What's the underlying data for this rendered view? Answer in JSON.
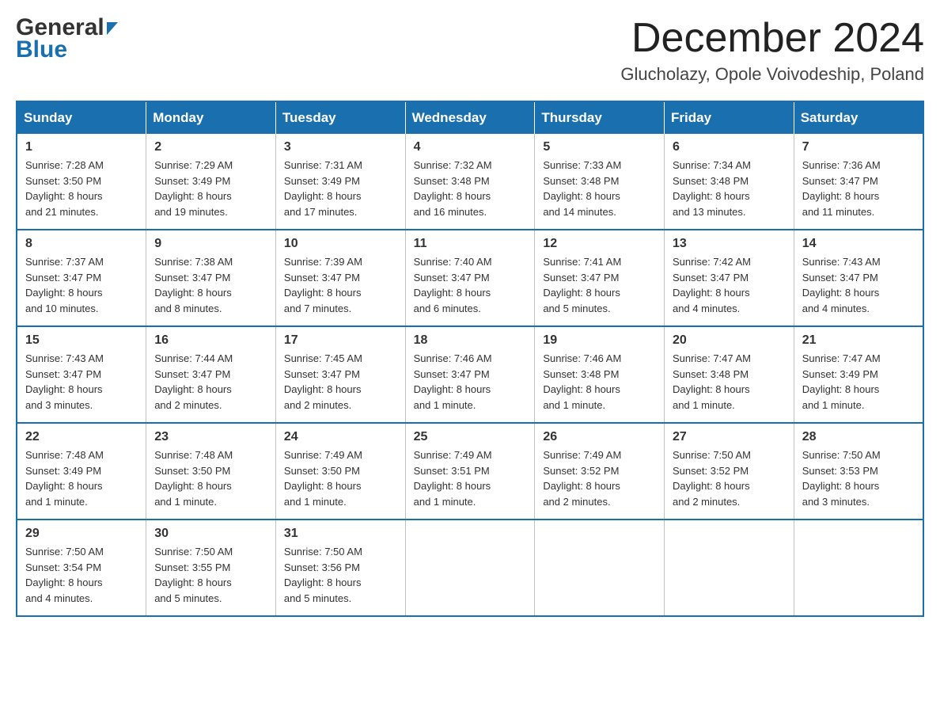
{
  "header": {
    "logo_line1": "General",
    "logo_line2": "Blue",
    "month_title": "December 2024",
    "subtitle": "Glucholazy, Opole Voivodeship, Poland"
  },
  "weekdays": [
    "Sunday",
    "Monday",
    "Tuesday",
    "Wednesday",
    "Thursday",
    "Friday",
    "Saturday"
  ],
  "weeks": [
    [
      {
        "day": "1",
        "sunrise": "7:28 AM",
        "sunset": "3:50 PM",
        "daylight": "8 hours and 21 minutes."
      },
      {
        "day": "2",
        "sunrise": "7:29 AM",
        "sunset": "3:49 PM",
        "daylight": "8 hours and 19 minutes."
      },
      {
        "day": "3",
        "sunrise": "7:31 AM",
        "sunset": "3:49 PM",
        "daylight": "8 hours and 17 minutes."
      },
      {
        "day": "4",
        "sunrise": "7:32 AM",
        "sunset": "3:48 PM",
        "daylight": "8 hours and 16 minutes."
      },
      {
        "day": "5",
        "sunrise": "7:33 AM",
        "sunset": "3:48 PM",
        "daylight": "8 hours and 14 minutes."
      },
      {
        "day": "6",
        "sunrise": "7:34 AM",
        "sunset": "3:48 PM",
        "daylight": "8 hours and 13 minutes."
      },
      {
        "day": "7",
        "sunrise": "7:36 AM",
        "sunset": "3:47 PM",
        "daylight": "8 hours and 11 minutes."
      }
    ],
    [
      {
        "day": "8",
        "sunrise": "7:37 AM",
        "sunset": "3:47 PM",
        "daylight": "8 hours and 10 minutes."
      },
      {
        "day": "9",
        "sunrise": "7:38 AM",
        "sunset": "3:47 PM",
        "daylight": "8 hours and 8 minutes."
      },
      {
        "day": "10",
        "sunrise": "7:39 AM",
        "sunset": "3:47 PM",
        "daylight": "8 hours and 7 minutes."
      },
      {
        "day": "11",
        "sunrise": "7:40 AM",
        "sunset": "3:47 PM",
        "daylight": "8 hours and 6 minutes."
      },
      {
        "day": "12",
        "sunrise": "7:41 AM",
        "sunset": "3:47 PM",
        "daylight": "8 hours and 5 minutes."
      },
      {
        "day": "13",
        "sunrise": "7:42 AM",
        "sunset": "3:47 PM",
        "daylight": "8 hours and 4 minutes."
      },
      {
        "day": "14",
        "sunrise": "7:43 AM",
        "sunset": "3:47 PM",
        "daylight": "8 hours and 4 minutes."
      }
    ],
    [
      {
        "day": "15",
        "sunrise": "7:43 AM",
        "sunset": "3:47 PM",
        "daylight": "8 hours and 3 minutes."
      },
      {
        "day": "16",
        "sunrise": "7:44 AM",
        "sunset": "3:47 PM",
        "daylight": "8 hours and 2 minutes."
      },
      {
        "day": "17",
        "sunrise": "7:45 AM",
        "sunset": "3:47 PM",
        "daylight": "8 hours and 2 minutes."
      },
      {
        "day": "18",
        "sunrise": "7:46 AM",
        "sunset": "3:47 PM",
        "daylight": "8 hours and 1 minute."
      },
      {
        "day": "19",
        "sunrise": "7:46 AM",
        "sunset": "3:48 PM",
        "daylight": "8 hours and 1 minute."
      },
      {
        "day": "20",
        "sunrise": "7:47 AM",
        "sunset": "3:48 PM",
        "daylight": "8 hours and 1 minute."
      },
      {
        "day": "21",
        "sunrise": "7:47 AM",
        "sunset": "3:49 PM",
        "daylight": "8 hours and 1 minute."
      }
    ],
    [
      {
        "day": "22",
        "sunrise": "7:48 AM",
        "sunset": "3:49 PM",
        "daylight": "8 hours and 1 minute."
      },
      {
        "day": "23",
        "sunrise": "7:48 AM",
        "sunset": "3:50 PM",
        "daylight": "8 hours and 1 minute."
      },
      {
        "day": "24",
        "sunrise": "7:49 AM",
        "sunset": "3:50 PM",
        "daylight": "8 hours and 1 minute."
      },
      {
        "day": "25",
        "sunrise": "7:49 AM",
        "sunset": "3:51 PM",
        "daylight": "8 hours and 1 minute."
      },
      {
        "day": "26",
        "sunrise": "7:49 AM",
        "sunset": "3:52 PM",
        "daylight": "8 hours and 2 minutes."
      },
      {
        "day": "27",
        "sunrise": "7:50 AM",
        "sunset": "3:52 PM",
        "daylight": "8 hours and 2 minutes."
      },
      {
        "day": "28",
        "sunrise": "7:50 AM",
        "sunset": "3:53 PM",
        "daylight": "8 hours and 3 minutes."
      }
    ],
    [
      {
        "day": "29",
        "sunrise": "7:50 AM",
        "sunset": "3:54 PM",
        "daylight": "8 hours and 4 minutes."
      },
      {
        "day": "30",
        "sunrise": "7:50 AM",
        "sunset": "3:55 PM",
        "daylight": "8 hours and 5 minutes."
      },
      {
        "day": "31",
        "sunrise": "7:50 AM",
        "sunset": "3:56 PM",
        "daylight": "8 hours and 5 minutes."
      },
      null,
      null,
      null,
      null
    ]
  ],
  "labels": {
    "sunrise": "Sunrise:",
    "sunset": "Sunset:",
    "daylight": "Daylight:"
  }
}
